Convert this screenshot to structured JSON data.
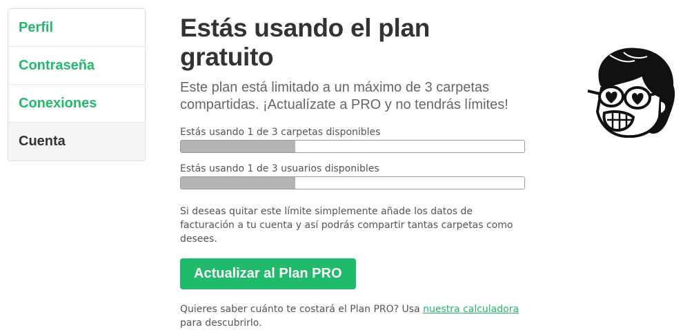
{
  "sidebar": {
    "items": [
      {
        "label": "Perfil"
      },
      {
        "label": "Contraseña"
      },
      {
        "label": "Conexiones"
      },
      {
        "label": "Cuenta"
      }
    ]
  },
  "main": {
    "title": "Estás usando el plan gratuito",
    "subtitle": "Este plan está limitado a un máximo de 3 carpetas compartidas. ¡Actualízate a PRO y no tendrás límites!",
    "usage": [
      {
        "label": "Estás usando 1 de 3 carpetas disponibles",
        "used": 1,
        "total": 3
      },
      {
        "label": "Estás usando 1 de 3 usuarios disponibles",
        "used": 1,
        "total": 3
      }
    ],
    "note": "Si deseas quitar este límite simplemente añade los datos de facturación a tu cuenta y así podrás compartir tantas carpetas como desees.",
    "cta_label": "Actualizar al Plan PRO",
    "footer": {
      "before": "Quieres saber cuánto te costará el Plan PRO? Usa ",
      "link": "nuestra calculadora",
      "after": " para descubrirlo."
    }
  },
  "colors": {
    "accent": "#1fba6a",
    "bar_fill": "#b4b4b4"
  },
  "icons": {
    "avatar": "cartoon-person-with-heart-glasses-icon"
  }
}
